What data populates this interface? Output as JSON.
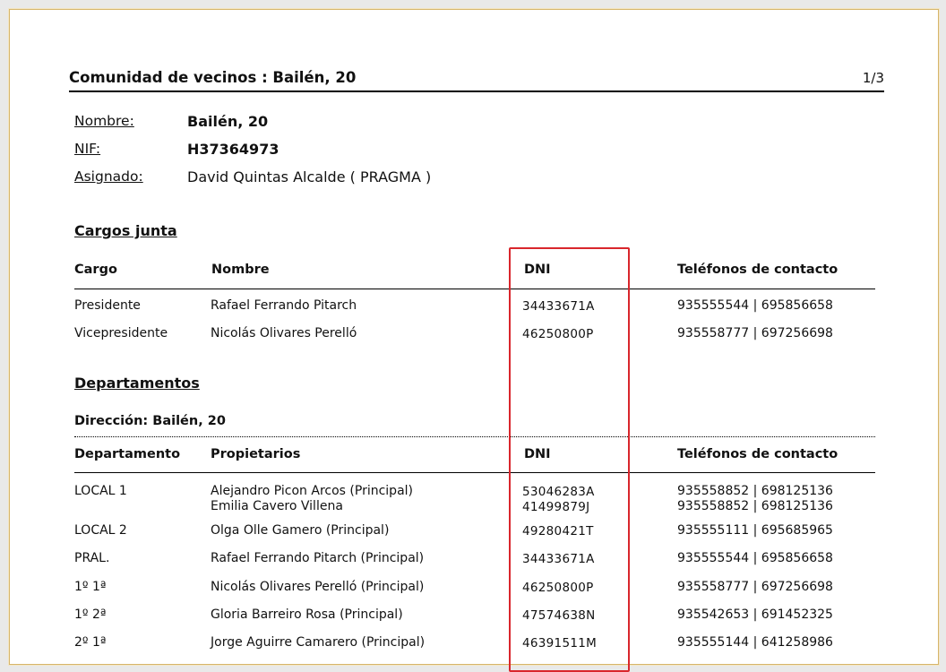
{
  "header": {
    "title": "Comunidad de vecinos : Bailén, 20",
    "page": "1/3"
  },
  "info": {
    "nombre_label": "Nombre:",
    "nombre_value": "Bailén, 20",
    "nif_label": "NIF:",
    "nif_value": "H37364973",
    "asignado_label": "Asignado:",
    "asignado_value": "David Quintas Alcalde ( PRAGMA )"
  },
  "cargos": {
    "title": "Cargos junta",
    "columns": [
      "Cargo",
      "Nombre",
      "DNI",
      "Teléfonos de contacto"
    ],
    "rows": [
      {
        "cargo": "Presidente",
        "nombre": "Rafael Ferrando Pitarch",
        "dni": "34433671A",
        "tel": "935555544 | 695856658"
      },
      {
        "cargo": "Vicepresidente",
        "nombre": "Nicolás Olivares Perelló",
        "dni": "46250800P",
        "tel": "935558777 | 697256698"
      }
    ]
  },
  "departamentos": {
    "title": "Departamentos",
    "address": "Dirección: Bailén, 20",
    "columns": [
      "Departamento",
      "Propietarios",
      "DNI",
      "Teléfonos de contacto"
    ],
    "rows": [
      {
        "dep": "LOCAL 1",
        "owner1": "Alejandro Picon Arcos (Principal)",
        "dni1": "53046283A",
        "tel1": "935558852 | 698125136",
        "owner2": "Emilia Cavero Villena",
        "dni2": "41499879J",
        "tel2": "935558852 | 698125136"
      },
      {
        "dep": "LOCAL 2",
        "owner1": "Olga Olle Gamero (Principal)",
        "dni1": "49280421T",
        "tel1": "935555111 | 695685965"
      },
      {
        "dep": "PRAL.",
        "owner1": "Rafael Ferrando Pitarch (Principal)",
        "dni1": "34433671A",
        "tel1": "935555544 | 695856658"
      },
      {
        "dep": "1º 1ª",
        "owner1": "Nicolás Olivares Perelló (Principal)",
        "dni1": "46250800P",
        "tel1": "935558777 | 697256698"
      },
      {
        "dep": "1º 2ª",
        "owner1": "Gloria Barreiro Rosa (Principal)",
        "dni1": "47574638N",
        "tel1": "935542653 | 691452325"
      },
      {
        "dep": "2º 1ª",
        "owner1": "Jorge Aguirre Camarero (Principal)",
        "dni1": "46391511M",
        "tel1": "935555144 | 641258986"
      }
    ]
  },
  "highlight_color": "#d9262c"
}
